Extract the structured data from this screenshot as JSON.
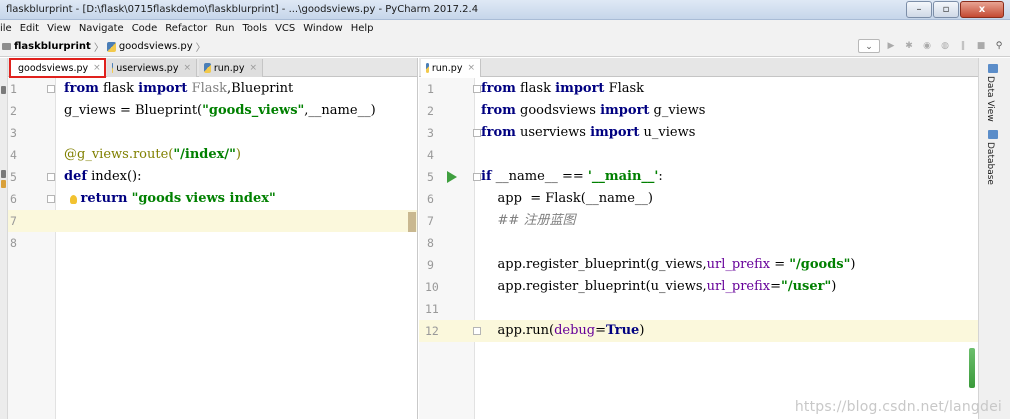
{
  "window": {
    "title": "flaskblurprint - [D:\\flask\\0715flaskdemo\\flaskblurprint] - ...\\goodsviews.py - PyCharm 2017.2.4",
    "buttons": {
      "minimize": "–",
      "restore": "▫",
      "close": "x"
    }
  },
  "menu": [
    "ile",
    "Edit",
    "View",
    "Navigate",
    "Code",
    "Refactor",
    "Run",
    "Tools",
    "VCS",
    "Window",
    "Help"
  ],
  "breadcrumb": {
    "project": "flaskblurprint",
    "file": "goodsviews.py"
  },
  "left_editor": {
    "tabs": [
      {
        "label": "goodsviews.py",
        "close": "×"
      },
      {
        "label": "userviews.py",
        "close": "×"
      },
      {
        "label": "run.py",
        "close": "×"
      }
    ],
    "line_numbers": [
      "1",
      "2",
      "3",
      "4",
      "5",
      "6",
      "7",
      "8"
    ],
    "code": {
      "l1_kw1": "from",
      "l1_a": " flask ",
      "l1_kw2": "import",
      "l1_dim": " Flask",
      "l1_b": ",Blueprint",
      "l2_a": "g_views = Blueprint(",
      "l2_str": "\"goods_views\"",
      "l2_b": ",__name__)",
      "l4_deco": "@g_views.route(",
      "l4_str": "\"/index/\"",
      "l4_deco2": ")",
      "l5_kw": "def",
      "l5_a": " index():",
      "l6_pad": "    ",
      "l6_kw": "return",
      "l6_sp": " ",
      "l6_str": "\"goods views index\""
    }
  },
  "right_editor": {
    "tabs": [
      {
        "label": "run.py",
        "close": "×"
      }
    ],
    "line_numbers": [
      "1",
      "2",
      "3",
      "4",
      "5",
      "6",
      "7",
      "8",
      "9",
      "10",
      "11",
      "12"
    ],
    "code": {
      "l1_kw1": "from",
      "l1_a": " flask ",
      "l1_kw2": "import",
      "l1_b": " Flask",
      "l2_kw1": "from",
      "l2_a": " goodsviews ",
      "l2_kw2": "import",
      "l2_b": " g_views",
      "l3_kw1": "from",
      "l3_a": " userviews ",
      "l3_kw2": "import",
      "l3_b": " u_views",
      "l5_kw": "if",
      "l5_a": " __name__ == ",
      "l5_str": "'__main__'",
      "l5_b": ":",
      "l6_a": "    app  = Flask(__name__)",
      "l7_cmt": "    ## 注册蓝图",
      "l9_a": "    app.register_blueprint(g_views,",
      "l9_kwarg": "url_prefix",
      "l9_b": " = ",
      "l9_str": "\"/goods\"",
      "l9_c": ")",
      "l10_a": "    app.register_blueprint(u_views,",
      "l10_kwarg": "url_prefix",
      "l10_b": "=",
      "l10_str": "\"/user\"",
      "l10_c": ")",
      "l12_a": "    app.run(",
      "l12_kwarg": "debug",
      "l12_b": "=",
      "l12_kw": "True",
      "l12_c": ")"
    }
  },
  "side_tools": {
    "data_view": "Data View",
    "database": "Database"
  },
  "watermark": "https://blog.csdn.net/langdei",
  "colors": {
    "keyword": "#000080",
    "string": "#008000",
    "decorator": "#808000",
    "comment": "#808080",
    "current_line": "#fbf8dc",
    "tab_highlight": "#e0211d"
  }
}
